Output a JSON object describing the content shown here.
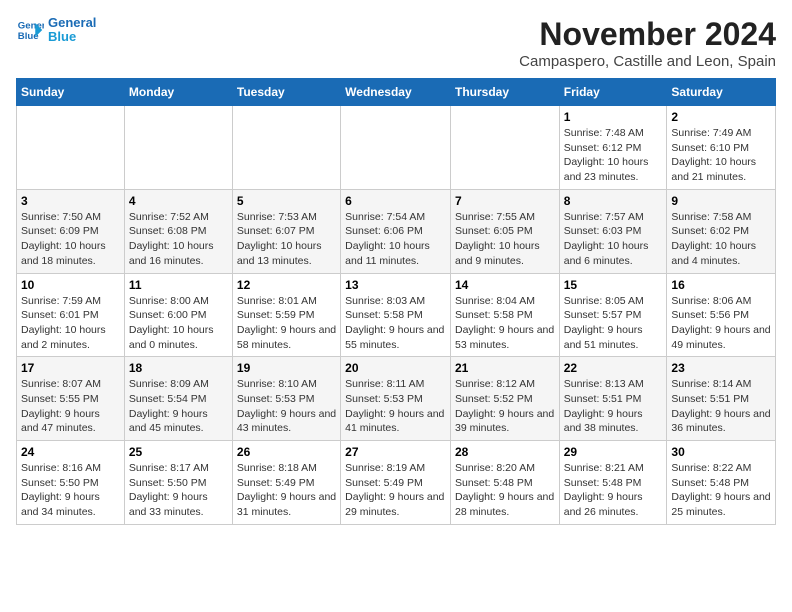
{
  "logo": {
    "line1": "General",
    "line2": "Blue"
  },
  "title": "November 2024",
  "subtitle": "Campaspero, Castille and Leon, Spain",
  "days_of_week": [
    "Sunday",
    "Monday",
    "Tuesday",
    "Wednesday",
    "Thursday",
    "Friday",
    "Saturday"
  ],
  "weeks": [
    [
      {
        "day": "",
        "info": ""
      },
      {
        "day": "",
        "info": ""
      },
      {
        "day": "",
        "info": ""
      },
      {
        "day": "",
        "info": ""
      },
      {
        "day": "",
        "info": ""
      },
      {
        "day": "1",
        "info": "Sunrise: 7:48 AM\nSunset: 6:12 PM\nDaylight: 10 hours and 23 minutes."
      },
      {
        "day": "2",
        "info": "Sunrise: 7:49 AM\nSunset: 6:10 PM\nDaylight: 10 hours and 21 minutes."
      }
    ],
    [
      {
        "day": "3",
        "info": "Sunrise: 7:50 AM\nSunset: 6:09 PM\nDaylight: 10 hours and 18 minutes."
      },
      {
        "day": "4",
        "info": "Sunrise: 7:52 AM\nSunset: 6:08 PM\nDaylight: 10 hours and 16 minutes."
      },
      {
        "day": "5",
        "info": "Sunrise: 7:53 AM\nSunset: 6:07 PM\nDaylight: 10 hours and 13 minutes."
      },
      {
        "day": "6",
        "info": "Sunrise: 7:54 AM\nSunset: 6:06 PM\nDaylight: 10 hours and 11 minutes."
      },
      {
        "day": "7",
        "info": "Sunrise: 7:55 AM\nSunset: 6:05 PM\nDaylight: 10 hours and 9 minutes."
      },
      {
        "day": "8",
        "info": "Sunrise: 7:57 AM\nSunset: 6:03 PM\nDaylight: 10 hours and 6 minutes."
      },
      {
        "day": "9",
        "info": "Sunrise: 7:58 AM\nSunset: 6:02 PM\nDaylight: 10 hours and 4 minutes."
      }
    ],
    [
      {
        "day": "10",
        "info": "Sunrise: 7:59 AM\nSunset: 6:01 PM\nDaylight: 10 hours and 2 minutes."
      },
      {
        "day": "11",
        "info": "Sunrise: 8:00 AM\nSunset: 6:00 PM\nDaylight: 10 hours and 0 minutes."
      },
      {
        "day": "12",
        "info": "Sunrise: 8:01 AM\nSunset: 5:59 PM\nDaylight: 9 hours and 58 minutes."
      },
      {
        "day": "13",
        "info": "Sunrise: 8:03 AM\nSunset: 5:58 PM\nDaylight: 9 hours and 55 minutes."
      },
      {
        "day": "14",
        "info": "Sunrise: 8:04 AM\nSunset: 5:58 PM\nDaylight: 9 hours and 53 minutes."
      },
      {
        "day": "15",
        "info": "Sunrise: 8:05 AM\nSunset: 5:57 PM\nDaylight: 9 hours and 51 minutes."
      },
      {
        "day": "16",
        "info": "Sunrise: 8:06 AM\nSunset: 5:56 PM\nDaylight: 9 hours and 49 minutes."
      }
    ],
    [
      {
        "day": "17",
        "info": "Sunrise: 8:07 AM\nSunset: 5:55 PM\nDaylight: 9 hours and 47 minutes."
      },
      {
        "day": "18",
        "info": "Sunrise: 8:09 AM\nSunset: 5:54 PM\nDaylight: 9 hours and 45 minutes."
      },
      {
        "day": "19",
        "info": "Sunrise: 8:10 AM\nSunset: 5:53 PM\nDaylight: 9 hours and 43 minutes."
      },
      {
        "day": "20",
        "info": "Sunrise: 8:11 AM\nSunset: 5:53 PM\nDaylight: 9 hours and 41 minutes."
      },
      {
        "day": "21",
        "info": "Sunrise: 8:12 AM\nSunset: 5:52 PM\nDaylight: 9 hours and 39 minutes."
      },
      {
        "day": "22",
        "info": "Sunrise: 8:13 AM\nSunset: 5:51 PM\nDaylight: 9 hours and 38 minutes."
      },
      {
        "day": "23",
        "info": "Sunrise: 8:14 AM\nSunset: 5:51 PM\nDaylight: 9 hours and 36 minutes."
      }
    ],
    [
      {
        "day": "24",
        "info": "Sunrise: 8:16 AM\nSunset: 5:50 PM\nDaylight: 9 hours and 34 minutes."
      },
      {
        "day": "25",
        "info": "Sunrise: 8:17 AM\nSunset: 5:50 PM\nDaylight: 9 hours and 33 minutes."
      },
      {
        "day": "26",
        "info": "Sunrise: 8:18 AM\nSunset: 5:49 PM\nDaylight: 9 hours and 31 minutes."
      },
      {
        "day": "27",
        "info": "Sunrise: 8:19 AM\nSunset: 5:49 PM\nDaylight: 9 hours and 29 minutes."
      },
      {
        "day": "28",
        "info": "Sunrise: 8:20 AM\nSunset: 5:48 PM\nDaylight: 9 hours and 28 minutes."
      },
      {
        "day": "29",
        "info": "Sunrise: 8:21 AM\nSunset: 5:48 PM\nDaylight: 9 hours and 26 minutes."
      },
      {
        "day": "30",
        "info": "Sunrise: 8:22 AM\nSunset: 5:48 PM\nDaylight: 9 hours and 25 minutes."
      }
    ]
  ]
}
